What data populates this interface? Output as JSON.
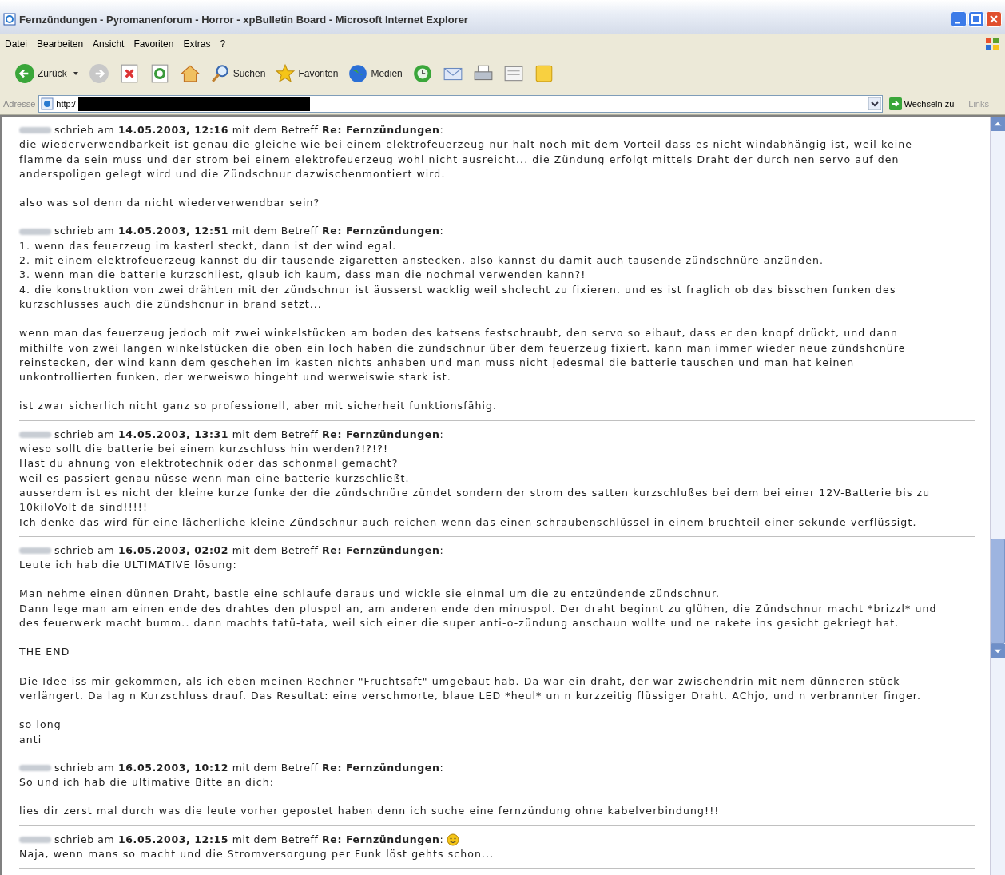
{
  "window": {
    "title": "Fernzündungen - Pyromanenforum - Horror - xpBulletin Board - Microsoft Internet Explorer"
  },
  "menu": [
    "Datei",
    "Bearbeiten",
    "Ansicht",
    "Favoriten",
    "Extras",
    "?"
  ],
  "toolbar": [
    {
      "kind": "back",
      "label": "Zurück"
    },
    {
      "kind": "forward"
    },
    {
      "kind": "stop"
    },
    {
      "kind": "refresh"
    },
    {
      "kind": "home"
    },
    {
      "kind": "search",
      "label": "Suchen"
    },
    {
      "kind": "favorites",
      "label": "Favoriten"
    },
    {
      "kind": "media",
      "label": "Medien"
    },
    {
      "kind": "history"
    },
    {
      "kind": "mail"
    },
    {
      "kind": "print"
    },
    {
      "kind": "edit"
    },
    {
      "kind": "note"
    }
  ],
  "address": {
    "label": "Adresse",
    "value": "http:/",
    "go": "Wechseln zu",
    "links": "Links"
  },
  "posts": [
    {
      "header": "schrieb am **14.05.2003, 12:16** mit dem Betreff **Re: Fernzündungen**:",
      "emoticon": false,
      "body": [
        [
          "die wiederverwendbarkeit ist genau die gleiche wie bei einem elektrofeuerzeug nur halt noch mit dem Vorteil dass es nicht windabhängig ist, weil keine",
          "flamme da sein muss und der strom bei einem elektrofeuerzeug wohl nicht ausreicht... die Zündung erfolgt mittels Draht der durch nen servo auf den",
          "anderspoligen gelegt wird und die Zündschnur dazwischenmontiert wird."
        ],
        [
          "also was sol denn da nicht wiederverwendbar sein?"
        ]
      ]
    },
    {
      "header": "schrieb am **14.05.2003, 12:51** mit dem Betreff **Re: Fernzündungen**:",
      "emoticon": false,
      "body": [
        [
          "1. wenn das feuerzeug im kasterl steckt, dann ist der wind egal.",
          "2. mit einem elektrofeuerzeug kannst du dir tausende zigaretten anstecken, also kannst du damit auch tausende zündschnüre anzünden.",
          "3. wenn man die batterie kurzschliest, glaub ich kaum, dass man die nochmal verwenden kann?!",
          "4. die konstruktion von zwei drähten mit der zündschnur ist äusserst wacklig weil shclecht zu fixieren. und es ist fraglich ob das bisschen funken des",
          "kurzschlusses auch die zündshcnur in brand setzt..."
        ],
        [
          "wenn man das feuerzeug jedoch mit zwei winkelstücken am boden des katsens festschraubt, den servo so eibaut, dass er den knopf drückt, und dann",
          "mithilfe von zwei langen winkelstücken die oben ein loch haben die zündschnur über dem feuerzeug fixiert. kann man immer wieder neue zündshcnüre",
          "reinstecken, der wind kann dem geschehen im kasten nichts anhaben und man muss nicht jedesmal die batterie tauschen und man hat keinen",
          "unkontrollierten funken, der werweiswo hingeht und werweiswie stark ist."
        ],
        [
          "ist zwar sicherlich nicht ganz so professionell, aber mit sicherheit funktionsfähig."
        ]
      ]
    },
    {
      "header": "schrieb am **14.05.2003, 13:31** mit dem Betreff **Re: Fernzündungen**:",
      "emoticon": false,
      "body": [
        [
          "wieso sollt die batterie bei einem kurzschluss hin werden?!?!?!",
          "Hast du ahnung von elektrotechnik oder das schonmal gemacht?",
          "weil es passiert genau nüsse wenn man eine batterie kurzschließt.",
          "ausserdem ist es nicht der kleine kurze funke der die zündschnüre zündet sondern der strom des satten kurzschlußes bei dem bei einer 12V-Batterie bis zu",
          "10kiloVolt da sind!!!!!",
          "Ich denke das wird für eine lächerliche kleine Zündschnur auch reichen wenn das einen schraubenschlüssel in einem bruchteil einer sekunde verflüssigt."
        ]
      ]
    },
    {
      "header": "schrieb am **16.05.2003, 02:02** mit dem Betreff **Re: Fernzündungen**:",
      "emoticon": false,
      "body": [
        [
          "Leute ich hab die ULTIMATIVE lösung:"
        ],
        [
          "Man nehme einen dünnen Draht, bastle eine schlaufe daraus und wickle sie einmal um die zu entzündende zündschnur.",
          "Dann lege man am einen ende des drahtes den pluspol an, am anderen ende den minuspol. Der draht beginnt zu glühen, die Zündschnur macht *brizzl* und",
          "des feuerwerk macht bumm.. dann machts tatü-tata, weil sich einer die super anti-o-zündung anschaun wollte und ne rakete ins gesicht gekriegt hat."
        ],
        [
          "THE END"
        ],
        [
          "Die Idee iss mir gekommen, als ich eben meinen Rechner \"Fruchtsaft\" umgebaut hab. Da war ein draht, der war zwischendrin mit nem dünneren stück",
          "verlängert. Da lag n Kurzschluss drauf. Das Resultat: eine verschmorte, blaue LED *heul* un n kurzzeitig flüssiger Draht. AChjo, und n verbrannter finger."
        ],
        [
          "so long",
          "anti"
        ]
      ]
    },
    {
      "header": "schrieb am **16.05.2003, 10:12** mit dem Betreff **Re: Fernzündungen**:",
      "emoticon": false,
      "body": [
        [
          "So und ich hab die ultimative Bitte an dich:"
        ],
        [
          "lies dir zerst mal durch was die leute vorher gepostet haben denn ich suche eine fernzündung ohne kabelverbindung!!!"
        ]
      ]
    },
    {
      "header": "schrieb am **16.05.2003, 12:15** mit dem Betreff **Re: Fernzündungen**:",
      "emoticon": true,
      "body": [
        [
          "Naja, wenn mans so macht und die Stromversorgung per Funk löst gehts schon..."
        ]
      ]
    }
  ]
}
